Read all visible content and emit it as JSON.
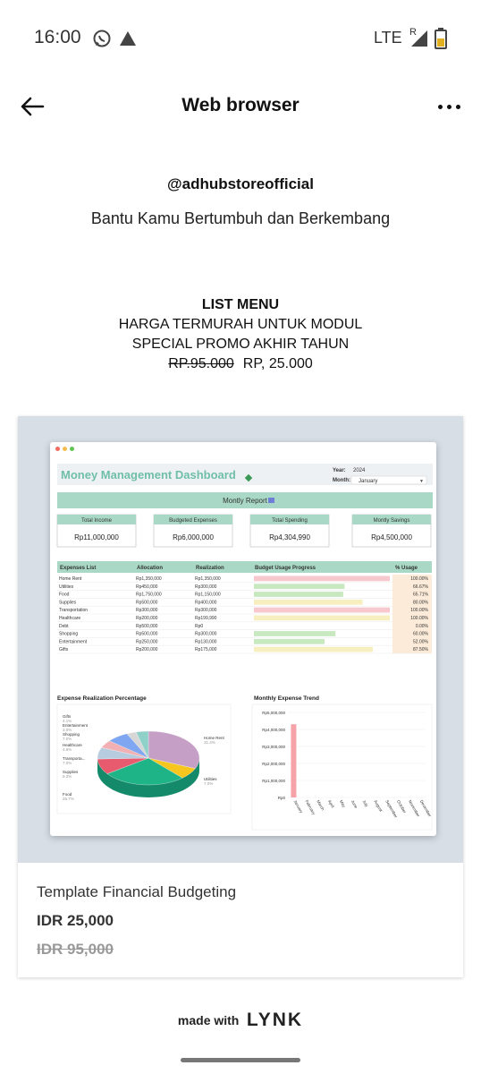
{
  "status_bar": {
    "time": "16:00",
    "network": "LTE",
    "roaming": "R"
  },
  "app_bar": {
    "title": "Web browser"
  },
  "profile": {
    "handle": "@adhubstoreofficial",
    "tagline": "Bantu Kamu Bertumbuh dan Berkembang"
  },
  "promo": {
    "title": "LIST MENU",
    "line1": "HARGA TERMURAH UNTUK MODUL",
    "line2": "SPECIAL PROMO AKHIR TAHUN",
    "old_price": "RP.95.000",
    "new_price": "RP, 25.000"
  },
  "product": {
    "name": "Template Financial Budgeting",
    "price": "IDR 25,000",
    "old_price": "IDR 95,000",
    "dashboard": {
      "title": "Money Management Dashboard",
      "year_label": "Year:",
      "year": "2024",
      "month_label": "Month:",
      "month": "January",
      "report_title": "Montly Report",
      "kpis": [
        {
          "label": "Total Income",
          "value": "Rp11,000,000"
        },
        {
          "label": "Budgeted Expenses",
          "value": "Rp6,000,000"
        },
        {
          "label": "Total Spending",
          "value": "Rp4,304,990"
        },
        {
          "label": "Montly Savings",
          "value": "Rp4,500,000"
        }
      ],
      "table_headers": [
        "Expenses List",
        "Allocation",
        "Realization",
        "Budget Usage Progress",
        "% Usage"
      ],
      "rows": [
        {
          "name": "Home Rent",
          "alloc": "Rp1,350,000",
          "real": "Rp1,350,000",
          "pct": "100.00%",
          "usage": 1.0,
          "color": "#f8c8cf"
        },
        {
          "name": "Utilities",
          "alloc": "Rp450,000",
          "real": "Rp300,000",
          "pct": "66.67%",
          "usage": 0.6667,
          "color": "#c8e8c0"
        },
        {
          "name": "Food",
          "alloc": "Rp1,750,000",
          "real": "Rp1,150,000",
          "pct": "65.71%",
          "usage": 0.6571,
          "color": "#c8e8c0"
        },
        {
          "name": "Supplies",
          "alloc": "Rp500,000",
          "real": "Rp400,000",
          "pct": "80.00%",
          "usage": 0.8,
          "color": "#f7efc0"
        },
        {
          "name": "Transportation",
          "alloc": "Rp300,000",
          "real": "Rp300,000",
          "pct": "100.00%",
          "usage": 1.0,
          "color": "#f8c8cf"
        },
        {
          "name": "Healthcare",
          "alloc": "Rp200,000",
          "real": "Rp199,990",
          "pct": "100.00%",
          "usage": 1.0,
          "color": "#f7efc0"
        },
        {
          "name": "Debt",
          "alloc": "Rp500,000",
          "real": "Rp0",
          "pct": "0.00%",
          "usage": 0.0,
          "color": "#c8e8c0"
        },
        {
          "name": "Shopping",
          "alloc": "Rp500,000",
          "real": "Rp300,000",
          "pct": "60.00%",
          "usage": 0.6,
          "color": "#c8e8c0"
        },
        {
          "name": "Entertainment",
          "alloc": "Rp250,000",
          "real": "Rp130,000",
          "pct": "52.00%",
          "usage": 0.52,
          "color": "#c8e8c0"
        },
        {
          "name": "Gifts",
          "alloc": "Rp200,000",
          "real": "Rp175,000",
          "pct": "87.50%",
          "usage": 0.875,
          "color": "#f7efc0"
        }
      ],
      "pie_title": "Expense Realization Percentage",
      "pie_labels": [
        {
          "name": "Home Rent",
          "pct": "31.4%"
        },
        {
          "name": "Utilities",
          "pct": "7.0%"
        },
        {
          "name": "Food",
          "pct": "26.7%"
        },
        {
          "name": "Supplies",
          "pct": "9.3%"
        },
        {
          "name": "Transporta...",
          "pct": "7.0%"
        },
        {
          "name": "Healthcare",
          "pct": "4.6%"
        },
        {
          "name": "Shopping",
          "pct": "7.0%"
        },
        {
          "name": "Entertainment",
          "pct": "3.0%"
        },
        {
          "name": "Gifts",
          "pct": "4.1%"
        }
      ],
      "trend_title": "Monthly Expense Trend",
      "trend_yticks": [
        "Rp5,000,000",
        "Rp4,000,000",
        "Rp3,000,000",
        "Rp2,000,000",
        "Rp1,000,000",
        "Rp0"
      ],
      "trend_months": [
        "January",
        "February",
        "March",
        "April",
        "May",
        "June",
        "July",
        "August",
        "September",
        "October",
        "November",
        "December"
      ],
      "trend_values": [
        4304990,
        0,
        0,
        0,
        0,
        0,
        0,
        0,
        0,
        0,
        0,
        0
      ],
      "colors": {
        "header_teal": "#a9d9c6",
        "accent_pink": "#f5a3a8"
      }
    }
  },
  "footer": {
    "made_with": "made with",
    "brand": "LYNK"
  }
}
